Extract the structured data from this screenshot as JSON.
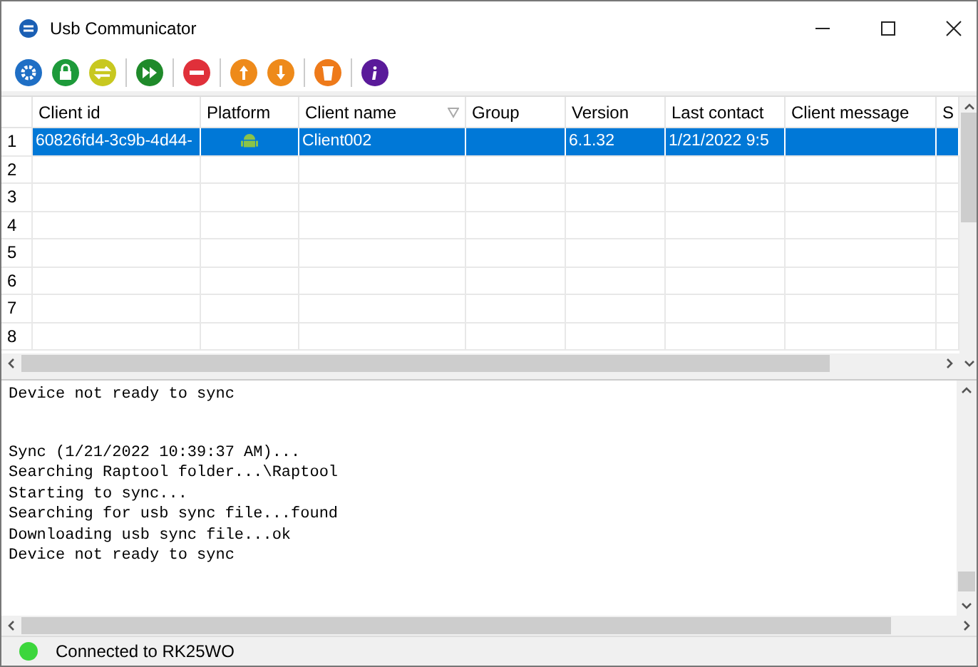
{
  "window": {
    "title": "Usb Communicator"
  },
  "grid": {
    "columns": [
      {
        "label": "Client id"
      },
      {
        "label": "Platform"
      },
      {
        "label": "Client name",
        "filter": true
      },
      {
        "label": "Group"
      },
      {
        "label": "Version"
      },
      {
        "label": "Last contact"
      },
      {
        "label": "Client message"
      },
      {
        "label": "S"
      }
    ],
    "rows": [
      {
        "number": "1",
        "selected": true,
        "cells": [
          {
            "kind": "text",
            "text": "60826fd4-3c9b-4d44-"
          },
          {
            "kind": "icon"
          },
          {
            "kind": "text",
            "text": "Client002"
          },
          {
            "kind": "blank"
          },
          {
            "kind": "text",
            "text": "6.1.32"
          },
          {
            "kind": "text",
            "text": "1/21/2022 9:5"
          },
          {
            "kind": "blank"
          },
          {
            "kind": "blank"
          }
        ]
      },
      {
        "number": "2",
        "selected": false
      },
      {
        "number": "3",
        "selected": false
      },
      {
        "number": "4",
        "selected": false
      },
      {
        "number": "5",
        "selected": false
      },
      {
        "number": "6",
        "selected": false
      },
      {
        "number": "7",
        "selected": false
      },
      {
        "number": "8",
        "selected": false
      }
    ]
  },
  "log": [
    {
      "lines": [
        "Device not ready to sync"
      ]
    },
    {
      "lines": [
        "Sync (1/21/2022 10:39:37 AM)...",
        "Searching Raptool folder...\\Raptool",
        "Starting to sync...",
        "Searching for usb sync file...found",
        "Downloading usb sync file...ok",
        "Device not ready to sync"
      ]
    }
  ],
  "status_bar": {
    "connected": true,
    "text": "Connected to RK25WO"
  }
}
